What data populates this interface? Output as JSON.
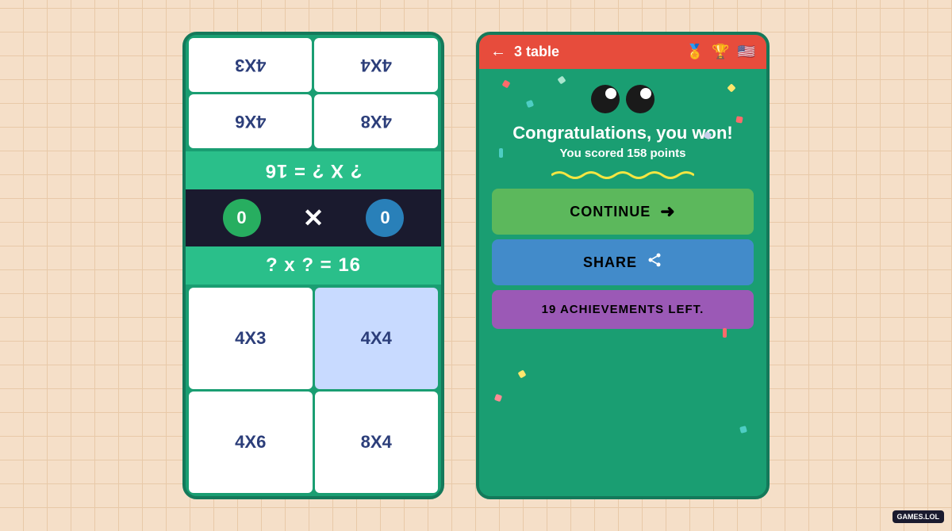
{
  "background": {
    "color": "#f5dfc8"
  },
  "left_card": {
    "grid_top": [
      {
        "label": "4X8",
        "tinted": false
      },
      {
        "label": "4X6",
        "tinted": false
      },
      {
        "label": "4X4",
        "tinted": false
      },
      {
        "label": "4X3",
        "tinted": false
      }
    ],
    "question_flipped": "? X ? = 16",
    "score_left": "0",
    "score_right": "0",
    "question": "? x ? = 16",
    "grid_bottom": [
      {
        "label": "4X3",
        "tinted": false
      },
      {
        "label": "4X4",
        "tinted": true
      },
      {
        "label": "4X6",
        "tinted": false
      },
      {
        "label": "8X4",
        "tinted": false
      }
    ]
  },
  "right_card": {
    "header": {
      "back_label": "←",
      "title": "3 table",
      "icon_bar": "🏅",
      "icon_trophy": "🏆",
      "icon_flag": "🇺🇸"
    },
    "eyes": [
      "👁",
      "👁"
    ],
    "congrats_title": "Congratulations, you won!",
    "score_text": "You scored 158 points",
    "buttons": {
      "continue": {
        "label": "CONTINUE",
        "arrow": "➜"
      },
      "share": {
        "label": "SHARE",
        "icon": "⋘"
      },
      "achievements": {
        "label": "19 ACHIEVEMENTS LEFT."
      }
    }
  },
  "games_badge": "GAMES.LOL"
}
